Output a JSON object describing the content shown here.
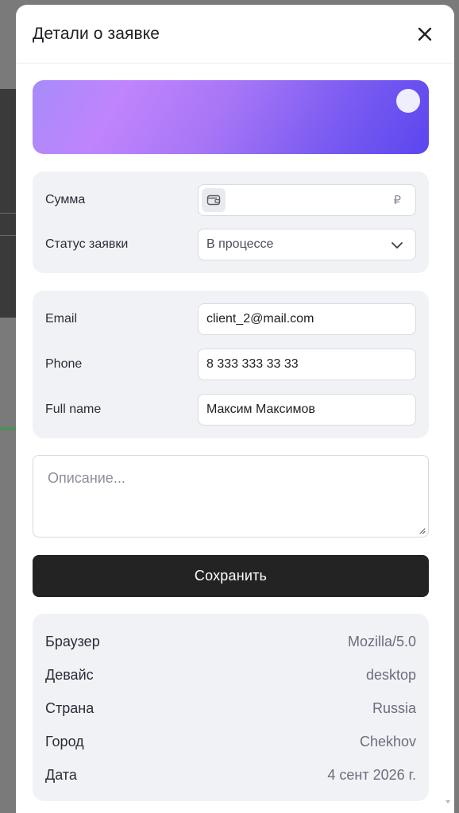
{
  "modal": {
    "title": "Детали о заявке"
  },
  "form": {
    "amount": {
      "label": "Сумма",
      "value": "",
      "currency": "₽"
    },
    "status": {
      "label": "Статус заявки",
      "selected": "В процессе"
    },
    "email": {
      "label": "Email",
      "value": "client_2@mail.com"
    },
    "phone": {
      "label": "Phone",
      "value": "8 333 333 33 33"
    },
    "full_name": {
      "label": "Full name",
      "value": "Максим Максимов"
    },
    "description": {
      "placeholder": "Описание..."
    },
    "save_label": "Сохранить"
  },
  "info": [
    {
      "key": "Браузер",
      "value": "Mozilla/5.0"
    },
    {
      "key": "Девайс",
      "value": "desktop"
    },
    {
      "key": "Страна",
      "value": "Russia"
    },
    {
      "key": "Город",
      "value": "Chekhov"
    },
    {
      "key": "Дата",
      "value": "4 сент 2026 г."
    }
  ],
  "icons": {
    "close": "close-icon",
    "wallet": "wallet-icon",
    "chevron": "chevron-down-icon"
  },
  "colors": {
    "accent_gradient_start": "#a78bfa",
    "accent_gradient_end": "#5a46ee",
    "save_button": "#232323",
    "panel_bg": "#f1f2f6"
  }
}
